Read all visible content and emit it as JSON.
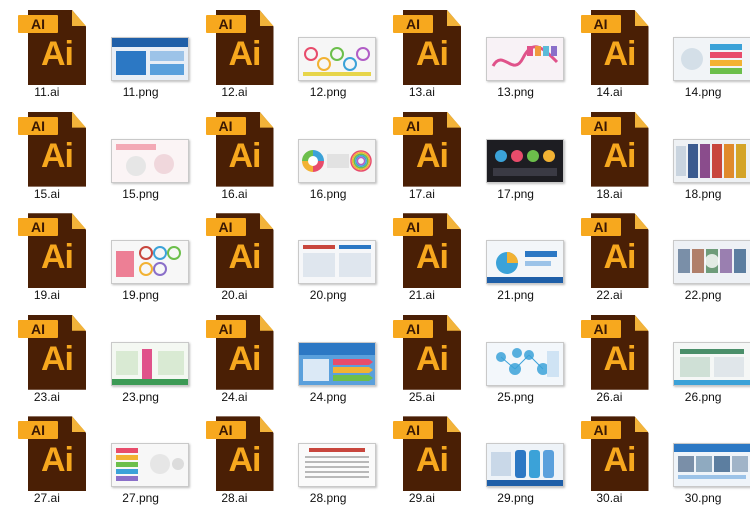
{
  "items": [
    {
      "type": "ai",
      "label": "11.ai"
    },
    {
      "type": "png",
      "label": "11.png",
      "theme": "blue-banner"
    },
    {
      "type": "ai",
      "label": "12.ai"
    },
    {
      "type": "png",
      "label": "12.png",
      "theme": "circles-light"
    },
    {
      "type": "ai",
      "label": "13.ai"
    },
    {
      "type": "png",
      "label": "13.png",
      "theme": "pink-wave"
    },
    {
      "type": "ai",
      "label": "14.ai"
    },
    {
      "type": "png",
      "label": "14.png",
      "theme": "color-steps"
    },
    {
      "type": "ai",
      "label": "15.ai"
    },
    {
      "type": "png",
      "label": "15.png",
      "theme": "pink-light"
    },
    {
      "type": "ai",
      "label": "16.ai"
    },
    {
      "type": "png",
      "label": "16.png",
      "theme": "ring-rainbow"
    },
    {
      "type": "ai",
      "label": "17.ai"
    },
    {
      "type": "png",
      "label": "17.png",
      "theme": "dark-bubbles"
    },
    {
      "type": "ai",
      "label": "18.ai"
    },
    {
      "type": "png",
      "label": "18.png",
      "theme": "color-columns"
    },
    {
      "type": "ai",
      "label": "19.ai"
    },
    {
      "type": "png",
      "label": "19.png",
      "theme": "red-bubbles"
    },
    {
      "type": "ai",
      "label": "20.ai"
    },
    {
      "type": "png",
      "label": "20.png",
      "theme": "red-blue-board"
    },
    {
      "type": "ai",
      "label": "21.ai"
    },
    {
      "type": "png",
      "label": "21.png",
      "theme": "blue-pie"
    },
    {
      "type": "ai",
      "label": "22.ai"
    },
    {
      "type": "png",
      "label": "22.png",
      "theme": "photo-mix"
    },
    {
      "type": "ai",
      "label": "23.ai"
    },
    {
      "type": "png",
      "label": "23.png",
      "theme": "green-board"
    },
    {
      "type": "ai",
      "label": "24.ai"
    },
    {
      "type": "png",
      "label": "24.png",
      "theme": "blue-arrows"
    },
    {
      "type": "ai",
      "label": "25.ai"
    },
    {
      "type": "png",
      "label": "25.png",
      "theme": "molecule"
    },
    {
      "type": "ai",
      "label": "26.ai"
    },
    {
      "type": "png",
      "label": "26.png",
      "theme": "green-panel"
    },
    {
      "type": "ai",
      "label": "27.ai"
    },
    {
      "type": "png",
      "label": "27.png",
      "theme": "color-tags"
    },
    {
      "type": "ai",
      "label": "28.ai"
    },
    {
      "type": "png",
      "label": "28.png",
      "theme": "text-board"
    },
    {
      "type": "ai",
      "label": "29.ai"
    },
    {
      "type": "png",
      "label": "29.png",
      "theme": "blue-shields"
    },
    {
      "type": "ai",
      "label": "30.ai"
    },
    {
      "type": "png",
      "label": "30.png",
      "theme": "blue-photos"
    }
  ],
  "icon": {
    "tab_text": "AI",
    "big_text": "Ai"
  },
  "colors": {
    "ai_dark": "#4a1f05",
    "ai_orange": "#f7a81e"
  }
}
